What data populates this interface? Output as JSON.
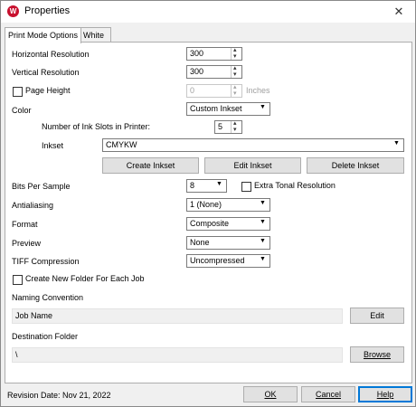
{
  "window": {
    "title": "Properties",
    "close_glyph": "✕"
  },
  "tabs": [
    "Print Mode Options",
    "White"
  ],
  "horizontal_resolution": {
    "label": "Horizontal Resolution",
    "value": "300"
  },
  "vertical_resolution": {
    "label": "Vertical Resolution",
    "value": "300"
  },
  "page_height": {
    "label": "Page Height",
    "value": "0",
    "unit": "Inches"
  },
  "color": {
    "label": "Color",
    "value": "Custom Inkset"
  },
  "ink_slots": {
    "label": "Number of Ink Slots in Printer:",
    "value": "5"
  },
  "inkset": {
    "label": "Inkset",
    "value": "CMYKW"
  },
  "inkset_buttons": {
    "create": "Create Inkset",
    "edit": "Edit Inkset",
    "delete": "Delete Inkset"
  },
  "bits_per_sample": {
    "label": "Bits Per Sample",
    "value": "8"
  },
  "extra_tonal": {
    "label": "Extra Tonal Resolution"
  },
  "antialiasing": {
    "label": "Antialiasing",
    "value": "1 (None)"
  },
  "format": {
    "label": "Format",
    "value": "Composite"
  },
  "preview": {
    "label": "Preview",
    "value": "None"
  },
  "tiff_compression": {
    "label": "TIFF Compression",
    "value": "Uncompressed"
  },
  "new_folder": {
    "label": "Create New Folder For Each Job"
  },
  "naming": {
    "label": "Naming Convention",
    "value": "Job Name",
    "button": "Edit"
  },
  "destination": {
    "label": "Destination Folder",
    "value": "\\",
    "button": "Browse"
  },
  "footer": {
    "revision": "Revision Date: Nov 21, 2022",
    "ok": "OK",
    "cancel": "Cancel",
    "help": "Help"
  }
}
